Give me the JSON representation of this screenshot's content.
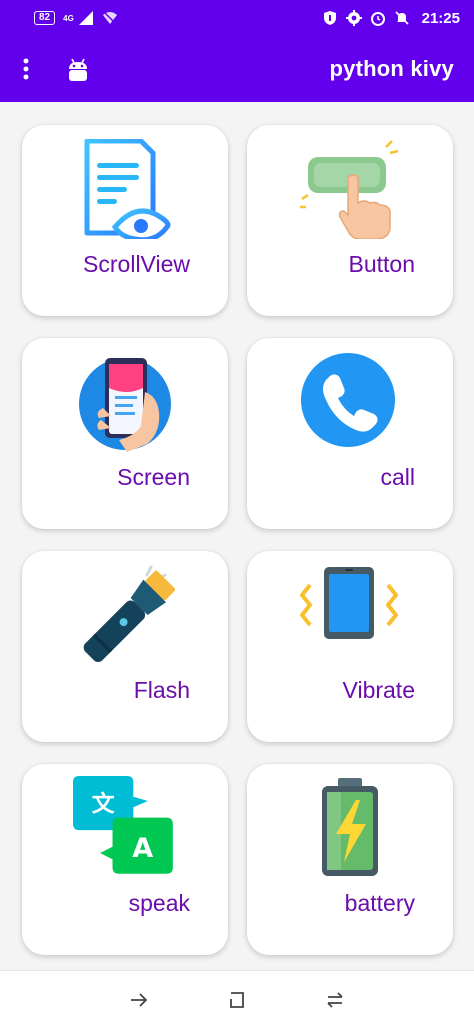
{
  "status_bar": {
    "battery_level": "82",
    "network_type": "4G",
    "time": "21:25",
    "icons": [
      "signal-icon",
      "wifi-icon",
      "shield-icon",
      "settings-icon",
      "alarm-icon",
      "bell-off-icon"
    ]
  },
  "app_bar": {
    "title": "python kivy",
    "color": "#6200ee",
    "icons": [
      "more-vert-icon",
      "android-icon"
    ]
  },
  "cards": [
    {
      "label": "ScrollView",
      "icon": "document-eye-icon"
    },
    {
      "label": "Button",
      "icon": "finger-press-button-icon"
    },
    {
      "label": "Screen",
      "icon": "phone-in-hand-icon"
    },
    {
      "label": "call",
      "icon": "phone-call-icon"
    },
    {
      "label": "Flash",
      "icon": "flashlight-icon"
    },
    {
      "label": "Vibrate",
      "icon": "vibrating-phone-icon"
    },
    {
      "label": "speak",
      "icon": "translate-icon"
    },
    {
      "label": "battery",
      "icon": "battery-charging-icon"
    }
  ],
  "nav_bar": {
    "icons": [
      "back-icon",
      "home-icon",
      "recents-icon"
    ]
  },
  "colors": {
    "accent": "#6200ee",
    "label": "#6a0dad",
    "background": "#f4f4f4"
  }
}
